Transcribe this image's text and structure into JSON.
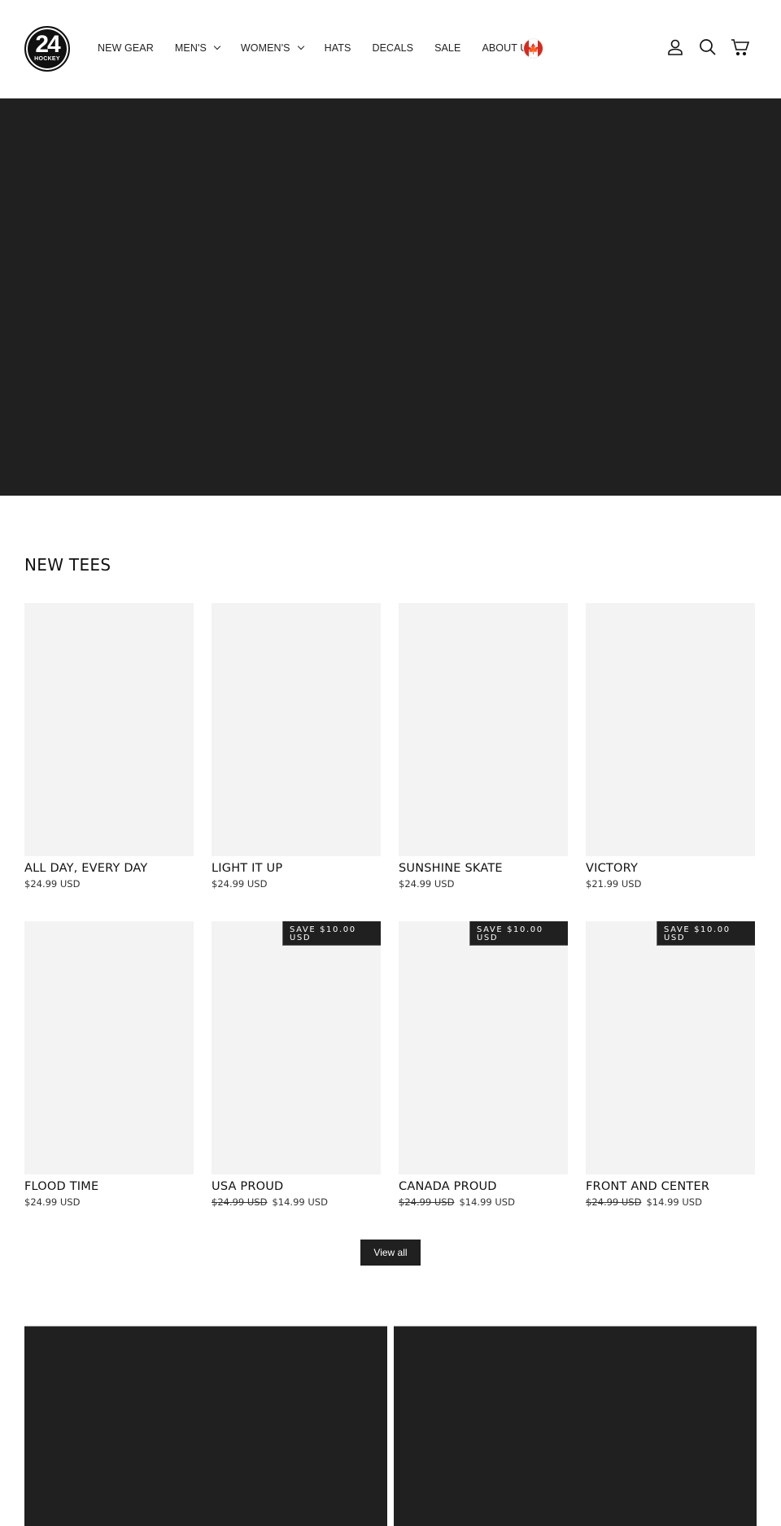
{
  "header": {
    "logo": {
      "number": "24",
      "word": "HOCKEY"
    },
    "nav": [
      {
        "label": "NEW GEAR",
        "has_dropdown": false
      },
      {
        "label": "MEN'S",
        "has_dropdown": true
      },
      {
        "label": "WOMEN'S",
        "has_dropdown": true
      },
      {
        "label": "HATS",
        "has_dropdown": false
      },
      {
        "label": "DECALS",
        "has_dropdown": false
      },
      {
        "label": "SALE",
        "has_dropdown": false
      },
      {
        "label": "ABOUT US",
        "has_dropdown": false
      }
    ],
    "country_flag": {
      "icon": "canada-flag-icon",
      "leaf": "🍁"
    },
    "icons": [
      "account-icon",
      "search-icon",
      "cart-icon"
    ]
  },
  "collection": {
    "title": "NEW TEES",
    "products": [
      {
        "title": "ALL DAY, EVERY DAY",
        "price": "$24.99 USD",
        "compare_price": null,
        "badge": null
      },
      {
        "title": "LIGHT IT UP",
        "price": "$24.99 USD",
        "compare_price": null,
        "badge": null
      },
      {
        "title": "SUNSHINE SKATE",
        "price": "$24.99 USD",
        "compare_price": null,
        "badge": null
      },
      {
        "title": "VICTORY",
        "price": "$21.99 USD",
        "compare_price": null,
        "badge": null
      },
      {
        "title": "FLOOD TIME",
        "price": "$24.99 USD",
        "compare_price": null,
        "badge": null
      },
      {
        "title": "USA PROUD",
        "price": "$14.99 USD",
        "compare_price": "$24.99 USD",
        "badge": "SAVE $10.00 USD"
      },
      {
        "title": "CANADA PROUD",
        "price": "$14.99 USD",
        "compare_price": "$24.99 USD",
        "badge": "SAVE $10.00 USD"
      },
      {
        "title": "FRONT AND CENTER",
        "price": "$14.99 USD",
        "compare_price": "$24.99 USD",
        "badge": "SAVE $10.00 USD"
      }
    ],
    "view_all_label": "View all"
  },
  "colors": {
    "dark": "#202020",
    "placeholder": "#f3f3f3",
    "flag_red": "#d52b1e"
  }
}
